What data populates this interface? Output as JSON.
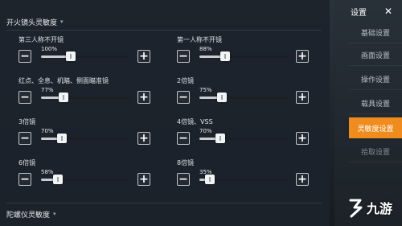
{
  "main": {
    "section_title": "开火镜头灵敏度",
    "next_section_title": "陀螺仪灵敏度",
    "settings": [
      {
        "label": "第三人称不开镜",
        "percent": "100%",
        "value": 100
      },
      {
        "label": "第一人称不开镜",
        "percent": "88%",
        "value": 88
      },
      {
        "label": "红点、全息、机瞄、侧面瞄准镜",
        "percent": "77%",
        "value": 77
      },
      {
        "label": "2倍镜",
        "percent": "75%",
        "value": 75
      },
      {
        "label": "3倍镜",
        "percent": "70%",
        "value": 70
      },
      {
        "label": "4倍镜、VSS",
        "percent": "70%",
        "value": 70
      },
      {
        "label": "6倍镜",
        "percent": "58%",
        "value": 58
      },
      {
        "label": "8倍镜",
        "percent": "35%",
        "value": 35
      }
    ],
    "slider_max": 300,
    "minus_symbol": "−",
    "plus_symbol": "+"
  },
  "sidebar": {
    "title": "设置",
    "close_symbol": "✕",
    "items": [
      {
        "label": "基础设置"
      },
      {
        "label": "画面设置"
      },
      {
        "label": "操作设置"
      },
      {
        "label": "载具设置"
      },
      {
        "label": "灵敏度设置",
        "active": true
      },
      {
        "label": "拾取设置"
      }
    ]
  },
  "watermark": {
    "text": "九游"
  },
  "colors": {
    "accent": "#f08b1e",
    "background": "#1c232b"
  }
}
